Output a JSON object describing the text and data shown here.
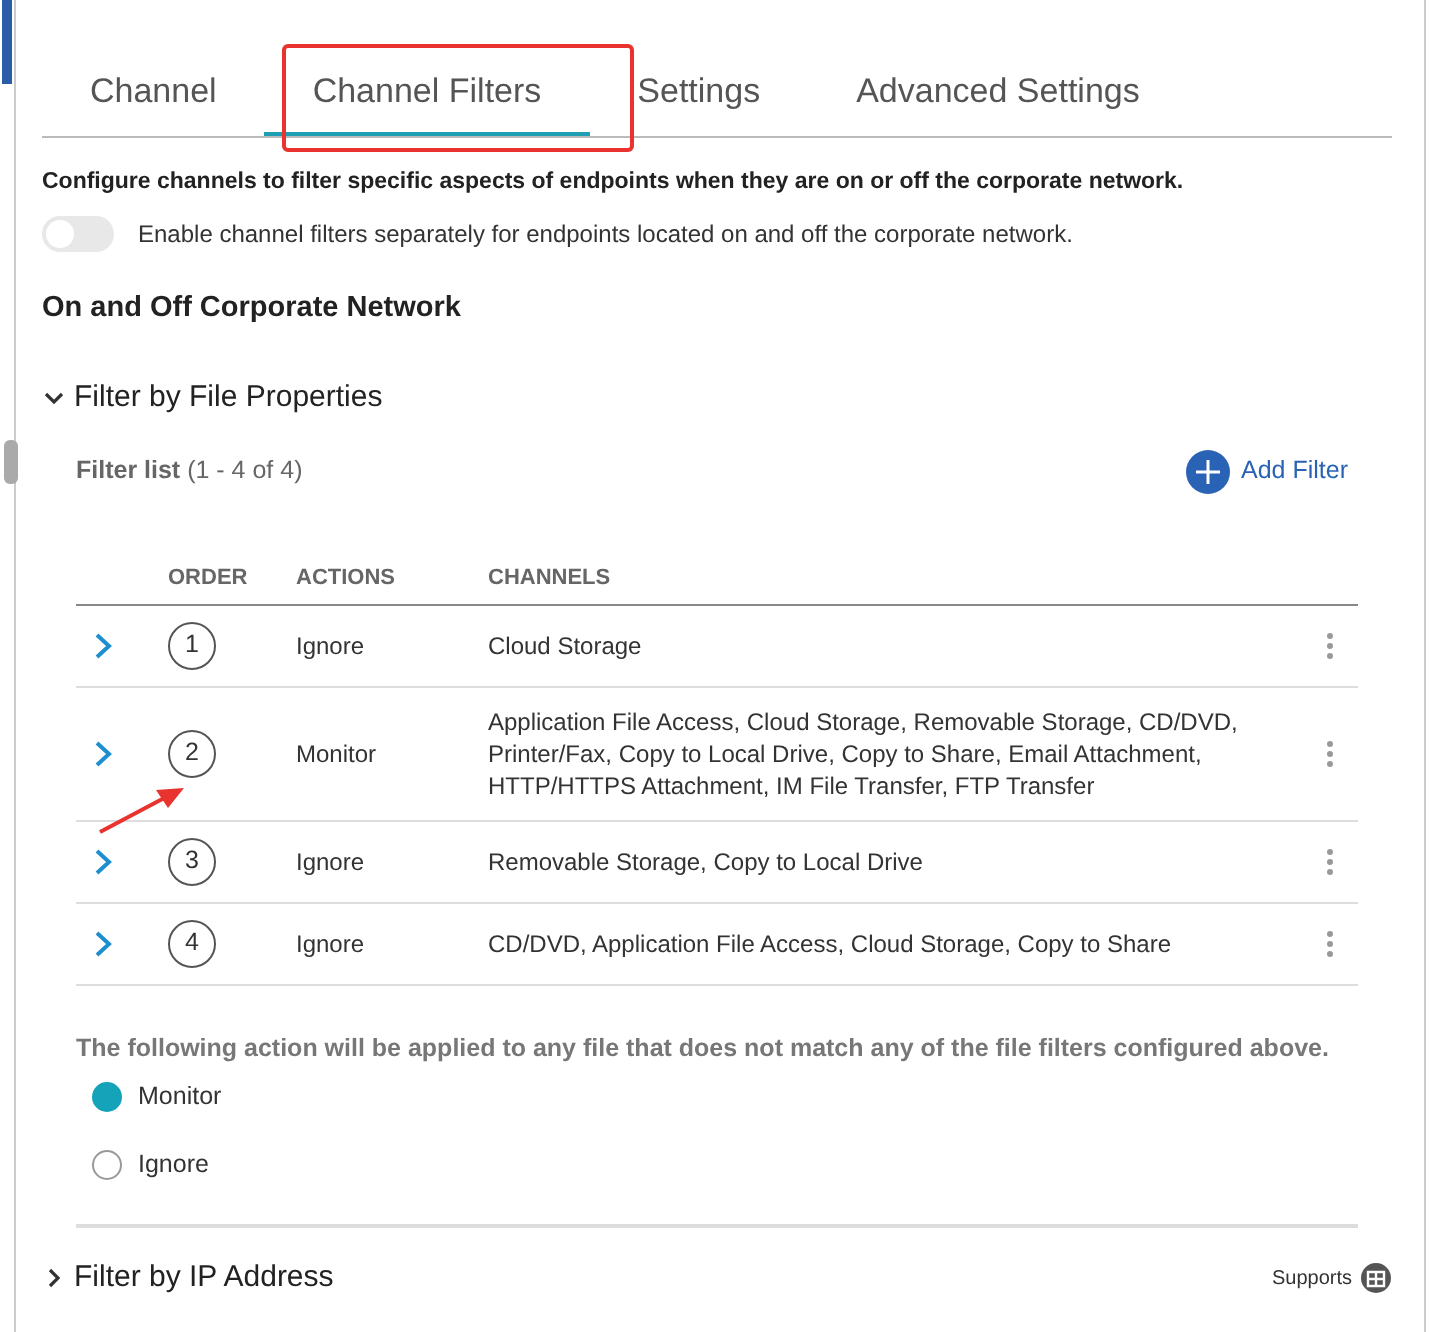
{
  "tabs": [
    {
      "label": "Channel",
      "selected": false
    },
    {
      "label": "Channel Filters",
      "selected": true
    },
    {
      "label": "Settings",
      "selected": false
    },
    {
      "label": "Advanced Settings",
      "selected": false
    }
  ],
  "intro": "Configure channels to filter specific aspects of endpoints when they are on or off the corporate network.",
  "toggle": {
    "label": "Enable channel filters separately for endpoints located on and off the corporate network.",
    "on": false
  },
  "section_title": "On and Off Corporate Network",
  "filter_group": {
    "title": "Filter by File Properties",
    "expanded": true,
    "list_label": "Filter list",
    "count": "(1 - 4 of 4)",
    "add_button": "Add Filter",
    "columns": [
      "ORDER",
      "ACTIONS",
      "CHANNELS"
    ],
    "rows": [
      {
        "order": "1",
        "action": "Ignore",
        "channels": "Cloud Storage"
      },
      {
        "order": "2",
        "action": "Monitor",
        "channels": "Application File Access, Cloud Storage, Removable Storage, CD/DVD, Printer/Fax, Copy to Local Drive, Copy to Share, Email Attachment, HTTP/HTTPS Attachment, IM File Transfer, FTP Transfer"
      },
      {
        "order": "3",
        "action": "Ignore",
        "channels": "Removable Storage, Copy to Local Drive"
      },
      {
        "order": "4",
        "action": "Ignore",
        "channels": "CD/DVD, Application File Access, Cloud Storage, Copy to Share"
      }
    ],
    "default_note": "The following action will be applied to any file that does not match any of the file filters configured above.",
    "options": [
      {
        "label": "Monitor",
        "selected": true
      },
      {
        "label": "Ignore",
        "selected": false
      }
    ]
  },
  "next_group": {
    "title": "Filter by IP Address",
    "expanded": false,
    "supports_label": "Supports"
  }
}
